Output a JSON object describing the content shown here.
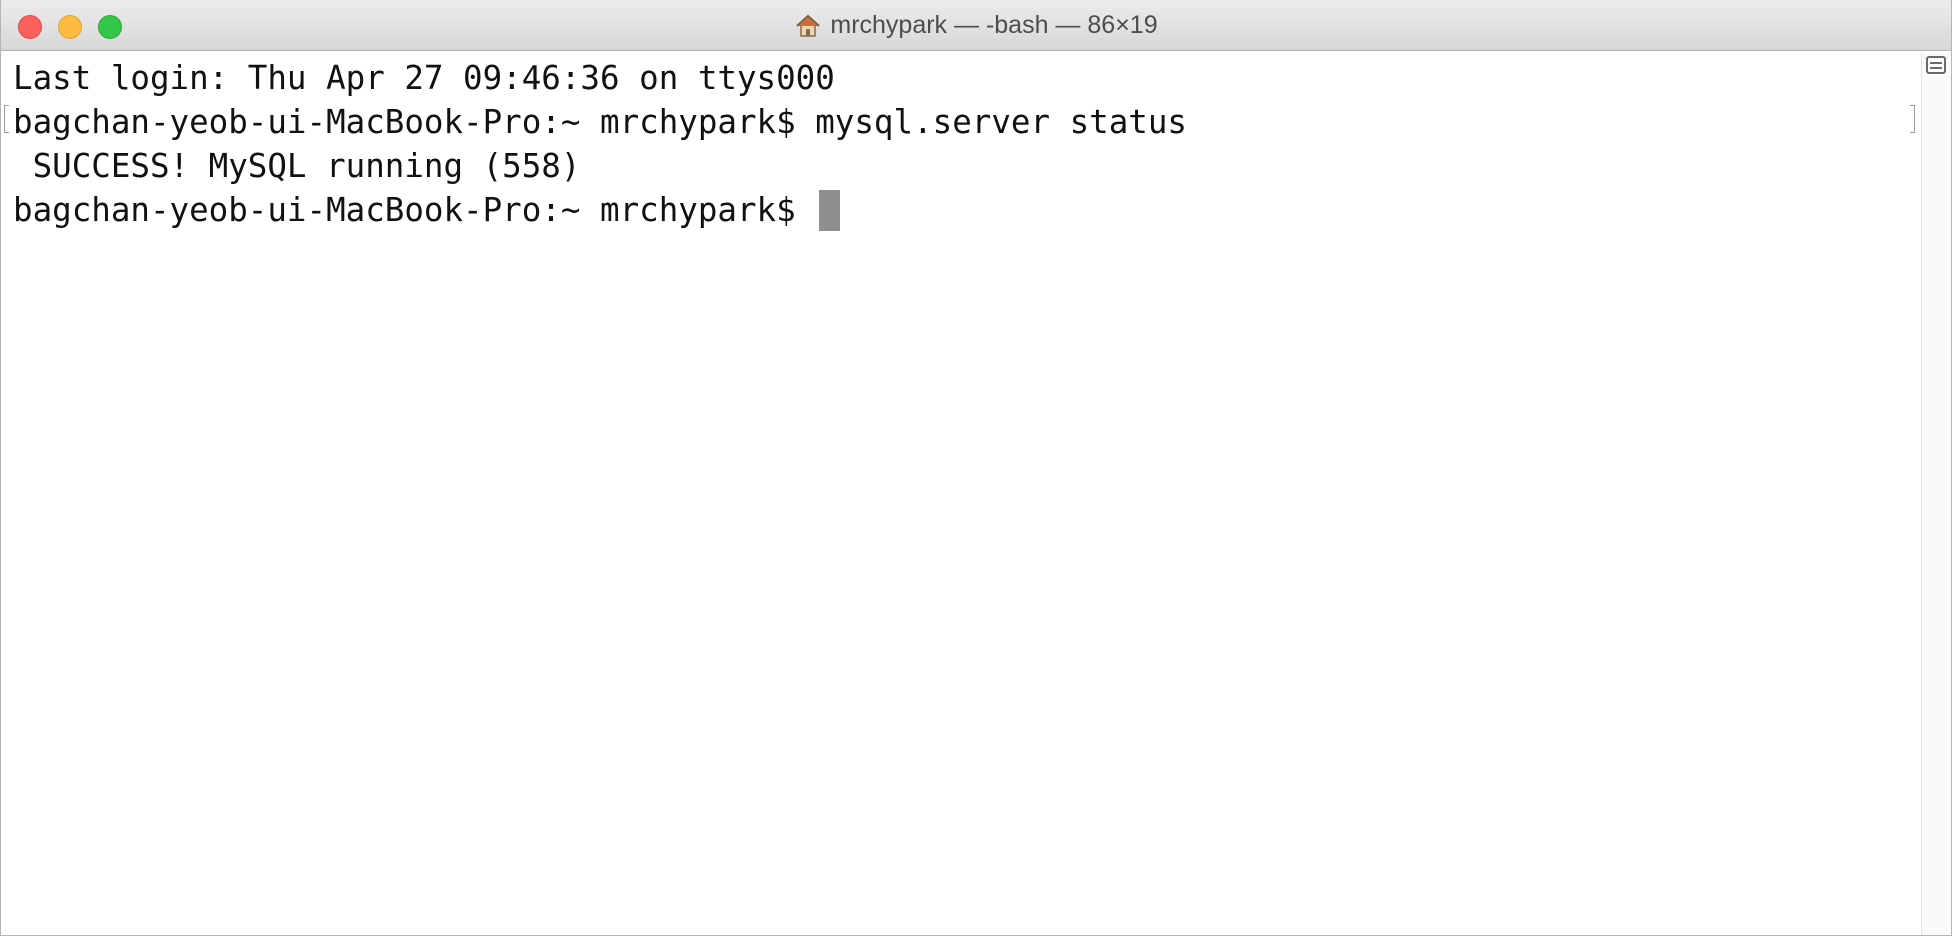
{
  "window": {
    "title": "mrchypark — -bash — 86×19",
    "home_icon": "home-icon",
    "buttons": {
      "close": "close-button",
      "minimize": "minimize-button",
      "zoom": "zoom-button"
    }
  },
  "terminal": {
    "lines": [
      "Last login: Thu Apr 27 09:46:36 on ttys000",
      "bagchan-yeob-ui-MacBook-Pro:~ mrchypark$ mysql.server status",
      " SUCCESS! MySQL running (558)"
    ],
    "prompt": "bagchan-yeob-ui-MacBook-Pro:~ mrchypark$ "
  },
  "colors": {
    "close": "#fc605c",
    "minimize": "#fdbc40",
    "zoom": "#34c84a",
    "cursor": "#8f8f8f"
  }
}
